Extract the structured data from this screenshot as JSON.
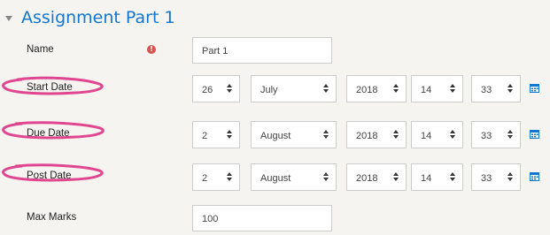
{
  "section": {
    "title": "Assignment Part 1"
  },
  "fields": {
    "name": {
      "label": "Name",
      "value": "Part 1",
      "required_icon": "exclamation-icon"
    },
    "start_date": {
      "label": "Start Date",
      "day": "26",
      "month": "July",
      "year": "2018",
      "hour": "14",
      "minute": "33"
    },
    "due_date": {
      "label": "Due Date",
      "day": "2",
      "month": "August",
      "year": "2018",
      "hour": "14",
      "minute": "33"
    },
    "post_date": {
      "label": "Post Date",
      "day": "2",
      "month": "August",
      "year": "2018",
      "hour": "14",
      "minute": "33"
    },
    "max_marks": {
      "label": "Max Marks",
      "value": "100"
    }
  },
  "icons": {
    "calendar": "calendar-icon",
    "collapse": "collapse-caret-icon"
  },
  "colors": {
    "title": "#1177d1",
    "annotation": "#e0468f",
    "required": "#d9534f",
    "calendar": "#1177d1"
  }
}
